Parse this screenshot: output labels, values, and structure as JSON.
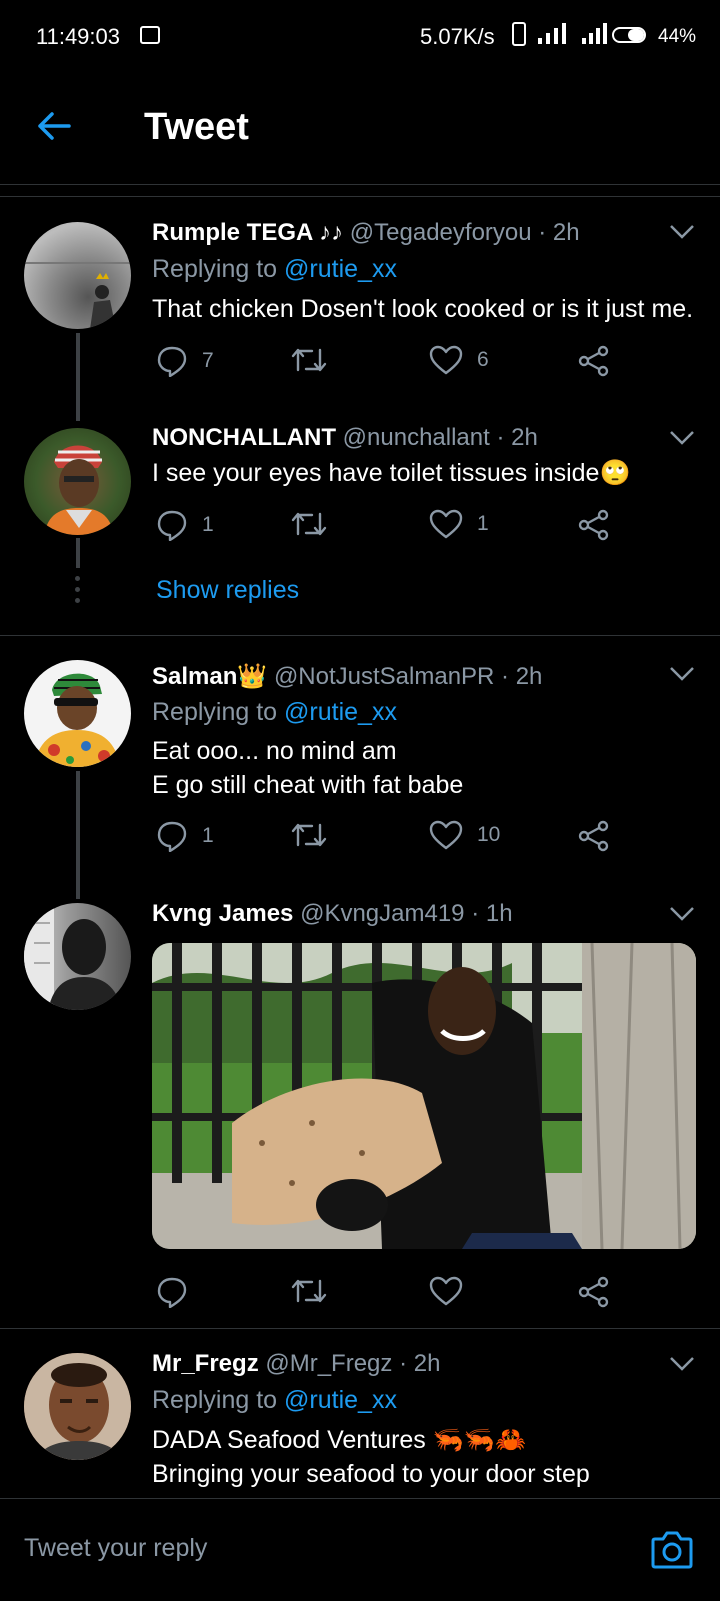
{
  "status_bar": {
    "time": "11:49:03",
    "network_speed": "5.07K/s",
    "battery": "44%"
  },
  "header": {
    "title": "Tweet"
  },
  "tweets": [
    {
      "name": "Rumple TEGA ♪♪",
      "handle": "@Tegadeyforyou · 2h",
      "replying_prefix": "Replying to",
      "replying_to": "@rutie_xx",
      "text": "That chicken Dosen't look cooked or is it just me.",
      "replies": "7",
      "likes": "6"
    },
    {
      "name": "NONCHALLANT",
      "handle": "@nunchallant · 2h",
      "text": "I see your eyes have toilet tissues inside🙄",
      "replies": "1",
      "likes": "1",
      "show_replies": "Show replies"
    },
    {
      "name": "Salman👑",
      "handle": "@NotJustSalmanPR · 2h",
      "replying_prefix": "Replying to",
      "replying_to": "@rutie_xx",
      "text_line1": "Eat ooo... no mind am",
      "text_line2": "E go still cheat with fat babe",
      "replies": "1",
      "likes": "10"
    },
    {
      "name": "Kvng James",
      "handle": "@KvngJam419 · 1h"
    },
    {
      "name": "Mr_Fregz",
      "handle": "@Mr_Fregz · 2h",
      "replying_prefix": "Replying to",
      "replying_to": "@rutie_xx",
      "text_line1": "DADA Seafood Ventures 🦐🦐🦀",
      "text_line2": "Bringing your seafood to your door step"
    }
  ],
  "compose": {
    "placeholder": "Tweet your reply"
  },
  "colors": {
    "background": "#000000",
    "accent": "#1d9bf0",
    "secondary_text": "#8b98a5",
    "divider": "#2f3336"
  }
}
